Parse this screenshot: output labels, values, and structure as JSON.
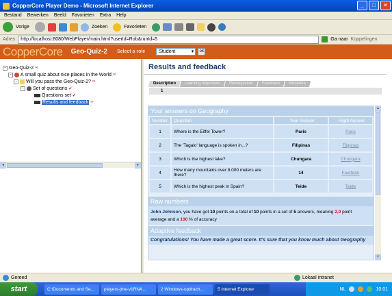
{
  "window": {
    "title": "CopperCore Player Demo - Microsoft Internet Explorer"
  },
  "menu": [
    "Bestand",
    "Bewerken",
    "Beeld",
    "Favorieten",
    "Extra",
    "Help"
  ],
  "toolbar": {
    "back": "Vorige",
    "search": "Zoeken",
    "favorites": "Favorieten"
  },
  "address": {
    "label": "Adres",
    "url": "http://localhost:8080/WebPlayer/main.html?userId=Rob&runId=5",
    "go": "Ga naar",
    "links": "Koppelingen"
  },
  "header": {
    "logo": "CopperCore",
    "quiz": "Geo-Quiz-2",
    "role_label": "Select a role",
    "role_value": "Student",
    "ok": "ok"
  },
  "tree": [
    {
      "label": "Geo-Quiz-2",
      "mark": "∞"
    },
    {
      "label": "A small quiz about nice places in the World",
      "mark": "∞"
    },
    {
      "label": "Will you pass the Geo-Quiz-2?",
      "mark": "∞"
    },
    {
      "label": "Set of questions",
      "mark": "✔"
    },
    {
      "label": "Questions set",
      "mark": "✔"
    },
    {
      "label": "Results and feedback",
      "mark": "∞"
    }
  ],
  "page": {
    "title": "Results and feedback",
    "tabs": [
      "Description",
      "Learning objectives",
      "Prerequisites",
      "Feedback",
      "Metadata"
    ],
    "page_number": "1"
  },
  "answers": {
    "heading": "Your answers on Geography",
    "columns": [
      "Number",
      "Question",
      "Your Answer",
      "Right Answer"
    ],
    "rows": [
      {
        "number": "1",
        "question": "Where is the Eiffel Tower?",
        "answer": "Paris",
        "correct": "Paris"
      },
      {
        "number": "2",
        "question": "The 'Tagalo' language is spoken in...?",
        "answer": "Filipinas",
        "correct": "Filipinas"
      },
      {
        "number": "3",
        "question": "Which is the highest lake?",
        "answer": "Chungara",
        "correct": "Chungara"
      },
      {
        "number": "4",
        "question": "How many mountains over 8.000 meters are there?",
        "answer": "14",
        "correct": "Fourteen"
      },
      {
        "number": "5",
        "question": "Which is the highest peak in Spain?",
        "answer": "Teide",
        "correct": "Teide"
      }
    ]
  },
  "raw": {
    "heading": "Raw numbers",
    "name": "John Johnson",
    "t1": ", you have got ",
    "points": "10",
    "t2": " points on a total of ",
    "total": "10",
    "t3": " points in a set of ",
    "count": "5",
    "t4": " answers, meaning ",
    "avg": "2,0",
    "t5": " point",
    "t6": "average and a ",
    "pct": "100",
    "t7": " % of accuracy"
  },
  "adaptive": {
    "heading": "Adaptive feedback",
    "text": "Congratulations! You have made a great score. It's sure that you know much about Geography"
  },
  "status": {
    "left": "Gereed",
    "zone": "Lokaal intranet"
  },
  "taskbar": {
    "start": "start",
    "tasks": [
      "C:\\Documents and Se...",
      "players-jme-v1RNA...",
      "2 Windows-opdrach...",
      "5 Internet Explorer"
    ],
    "lang": "NL",
    "time": "10:01"
  },
  "colors": {
    "header": "#d25c1a",
    "panel": "#e6eef8",
    "row": "#cde0f4",
    "head": "#b9d2ea",
    "title": "#1a3a6b"
  }
}
